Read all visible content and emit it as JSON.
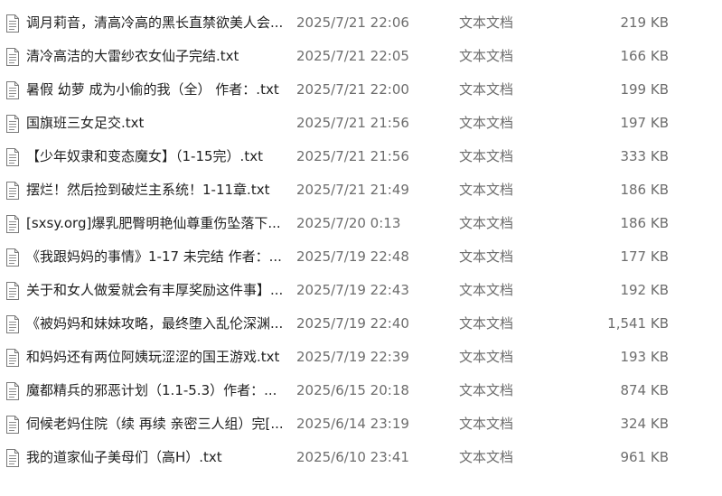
{
  "files": [
    {
      "name": "调月莉音，清高冷高的黑长直禁欲美人会...",
      "modified": "2025/7/21 22:06",
      "type": "文本文档",
      "size": "219 KB"
    },
    {
      "name": "清冷高洁的大雷纱衣女仙子完结.txt",
      "modified": "2025/7/21 22:05",
      "type": "文本文档",
      "size": "166 KB"
    },
    {
      "name": "暑假 幼萝 成为小偷的我（全） 作者：.txt",
      "modified": "2025/7/21 22:00",
      "type": "文本文档",
      "size": "199 KB"
    },
    {
      "name": "国旗班三女足交.txt",
      "modified": "2025/7/21 21:56",
      "type": "文本文档",
      "size": "197 KB"
    },
    {
      "name": "【少年奴隶和变态魔女】（1-15完）.txt",
      "modified": "2025/7/21 21:56",
      "type": "文本文档",
      "size": "333 KB"
    },
    {
      "name": "摆烂！然后捡到破烂主系统！1-11章.txt",
      "modified": "2025/7/21 21:49",
      "type": "文本文档",
      "size": "186 KB"
    },
    {
      "name": "[sxsy.org]爆乳肥臀明艳仙尊重伤坠落下...",
      "modified": "2025/7/20 0:13",
      "type": "文本文档",
      "size": "186 KB"
    },
    {
      "name": "《我跟妈妈的事情》1-17 未完结 作者：...",
      "modified": "2025/7/19 22:48",
      "type": "文本文档",
      "size": "177 KB"
    },
    {
      "name": "关于和女人做爱就会有丰厚奖励这件事】...",
      "modified": "2025/7/19 22:43",
      "type": "文本文档",
      "size": "192 KB"
    },
    {
      "name": "《被妈妈和妹妹攻略，最终堕入乱伦深渊...",
      "modified": "2025/7/19 22:40",
      "type": "文本文档",
      "size": "1,541 KB"
    },
    {
      "name": "和妈妈还有两位阿姨玩涩涩的国王游戏.txt",
      "modified": "2025/7/19 22:39",
      "type": "文本文档",
      "size": "193 KB"
    },
    {
      "name": "魔都精兵的邪恶计划（1.1-5.3）作者：...",
      "modified": "2025/6/15 20:18",
      "type": "文本文档",
      "size": "874 KB"
    },
    {
      "name": "伺候老妈住院（续 再续 亲密三人组）完[...",
      "modified": "2025/6/14 23:19",
      "type": "文本文档",
      "size": "324 KB"
    },
    {
      "name": "我的道家仙子美母们（高H）.txt",
      "modified": "2025/6/10 23:41",
      "type": "文本文档",
      "size": "961 KB"
    }
  ]
}
